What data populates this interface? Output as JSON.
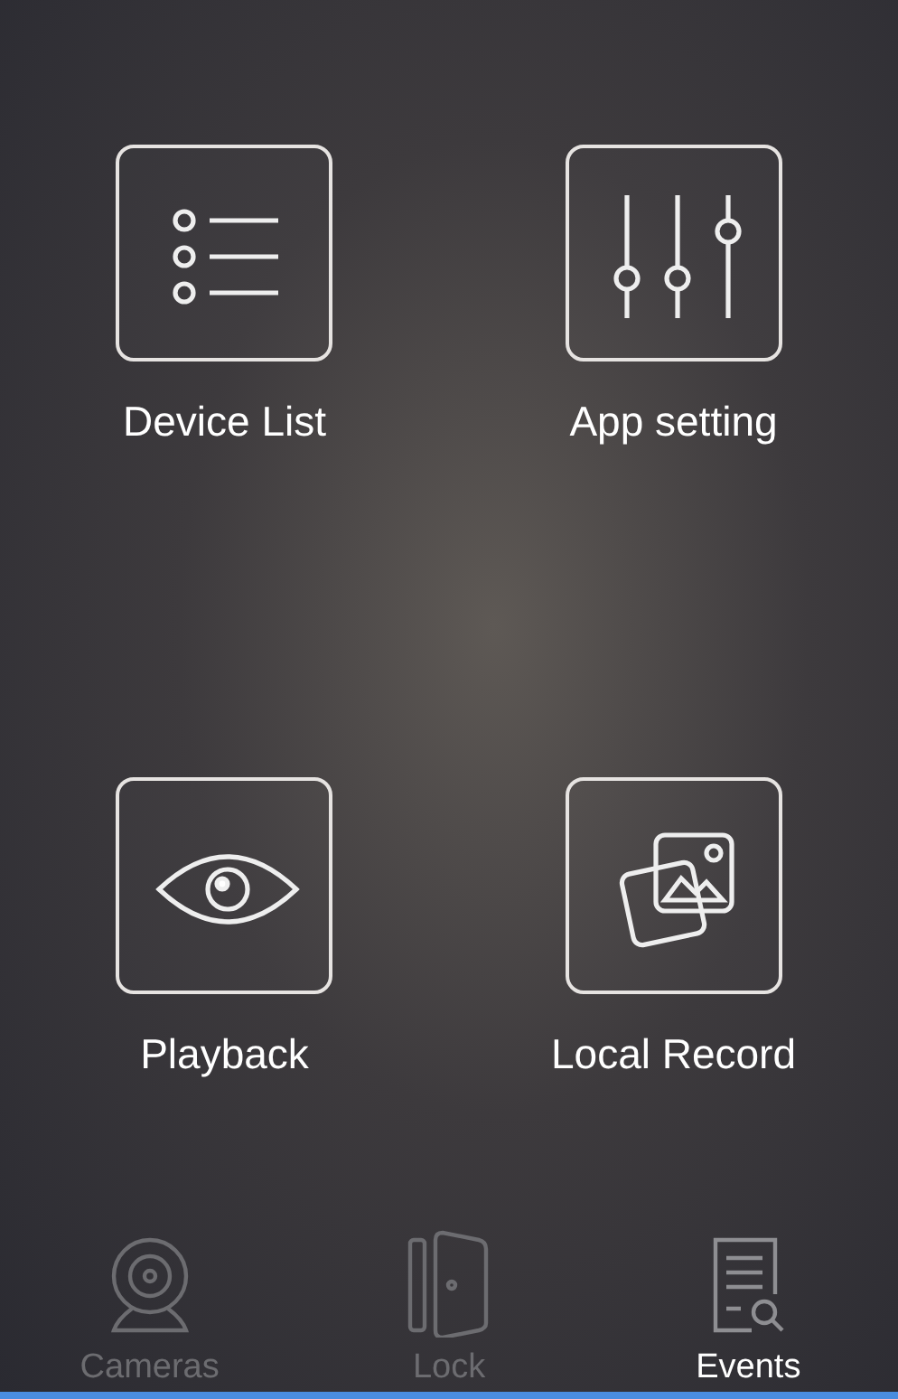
{
  "menu": [
    {
      "kind": "list",
      "label": "Device List"
    },
    {
      "kind": "sliders",
      "label": "App setting"
    },
    {
      "kind": "eye",
      "label": "Playback"
    },
    {
      "kind": "photos",
      "label": "Local Record"
    }
  ],
  "tabs": [
    {
      "kind": "camera",
      "label": "Cameras",
      "selected": false
    },
    {
      "kind": "door",
      "label": "Lock",
      "selected": false
    },
    {
      "kind": "report",
      "label": "Events",
      "selected": true
    }
  ]
}
